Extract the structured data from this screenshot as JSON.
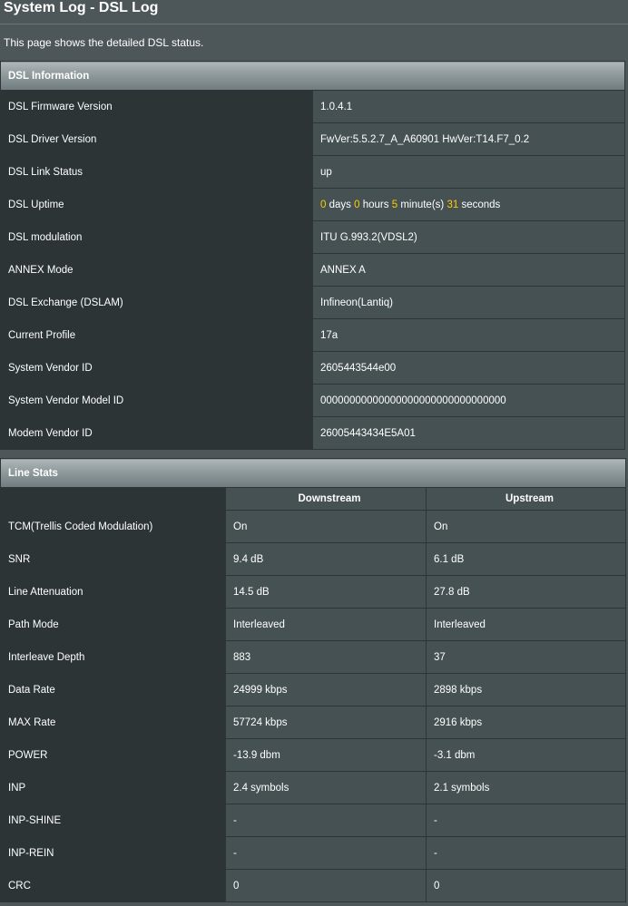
{
  "page": {
    "title": "System Log - DSL Log",
    "description": "This page shows the detailed DSL status."
  },
  "dsl_info": {
    "header": "DSL Information",
    "rows": [
      {
        "label": "DSL Firmware Version",
        "value": "1.0.4.1"
      },
      {
        "label": "DSL Driver Version",
        "value": "FwVer:5.5.2.7_A_A60901 HwVer:T14.F7_0.2"
      },
      {
        "label": "DSL Link Status",
        "value": "up"
      },
      {
        "label": "DSL Uptime",
        "value": ""
      },
      {
        "label": "DSL modulation",
        "value": "ITU G.993.2(VDSL2)"
      },
      {
        "label": "ANNEX Mode",
        "value": "ANNEX A"
      },
      {
        "label": "DSL Exchange (DSLAM)",
        "value": "Infineon(Lantiq)"
      },
      {
        "label": "Current Profile",
        "value": "17a"
      },
      {
        "label": "System Vendor ID",
        "value": "2605443544e00"
      },
      {
        "label": "System Vendor Model ID",
        "value": "00000000000000000000000000000000"
      },
      {
        "label": "Modem Vendor ID",
        "value": "26005443434E5A01"
      }
    ],
    "uptime": {
      "days": "0",
      "days_unit": "days",
      "hours": "0",
      "hours_unit": "hours",
      "minutes": "5",
      "minutes_unit": "minute(s)",
      "seconds": "31",
      "seconds_unit": "seconds"
    }
  },
  "line_stats": {
    "header": "Line Stats",
    "col_downstream": "Downstream",
    "col_upstream": "Upstream",
    "rows": [
      {
        "label": "TCM(Trellis Coded Modulation)",
        "down": "On",
        "up": "On"
      },
      {
        "label": "SNR",
        "down": "9.4 dB",
        "up": "6.1 dB"
      },
      {
        "label": "Line Attenuation",
        "down": "14.5 dB",
        "up": "27.8 dB"
      },
      {
        "label": "Path Mode",
        "down": "Interleaved",
        "up": "Interleaved"
      },
      {
        "label": "Interleave Depth",
        "down": "883",
        "up": "37"
      },
      {
        "label": "Data Rate",
        "down": "24999 kbps",
        "up": "2898 kbps"
      },
      {
        "label": "MAX Rate",
        "down": "57724 kbps",
        "up": "2916 kbps"
      },
      {
        "label": "POWER",
        "down": "-13.9 dbm",
        "up": "-3.1 dbm"
      },
      {
        "label": "INP",
        "down": "2.4 symbols",
        "up": "2.1 symbols"
      },
      {
        "label": "INP-SHINE",
        "down": "-",
        "up": "-"
      },
      {
        "label": "INP-REIN",
        "down": "-",
        "up": "-"
      },
      {
        "label": "CRC",
        "down": "0",
        "up": "0"
      }
    ]
  },
  "colors": {
    "background": "#4d5659",
    "label_cell": "#2c3436",
    "value_cell": "#465154",
    "highlight": "#ffcc00"
  }
}
